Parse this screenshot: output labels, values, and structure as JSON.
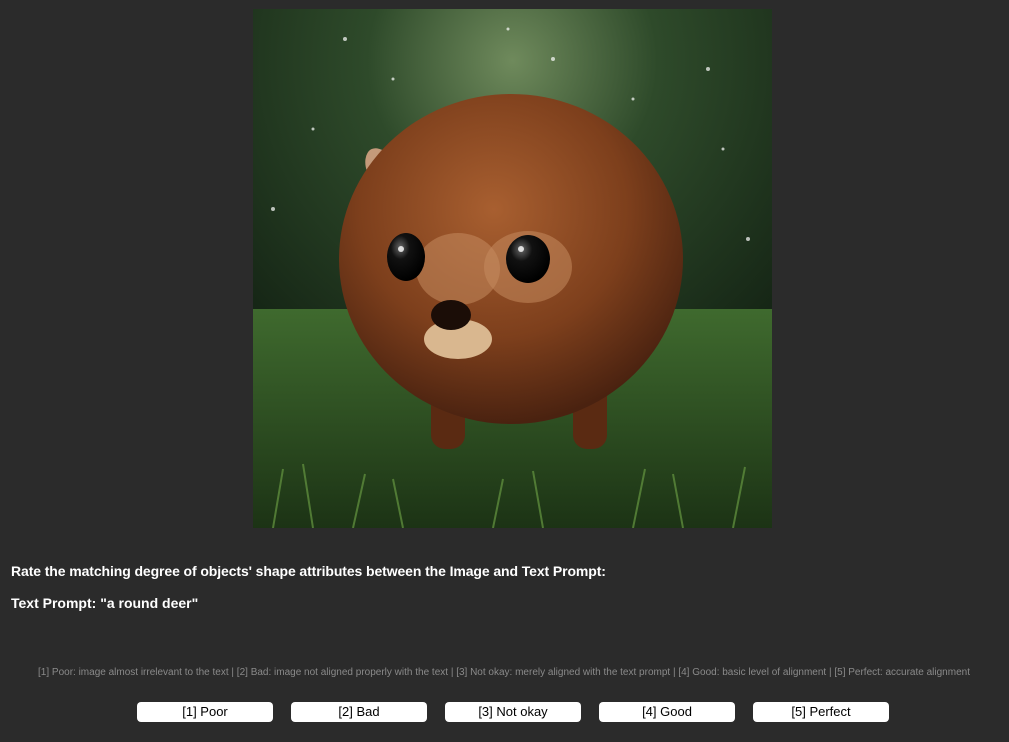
{
  "question": "Rate the matching degree of objects' shape attributes between the Image and Text Prompt:",
  "prompt": "Text Prompt: \"a round deer\"",
  "legend": "[1] Poor: image almost irrelevant to the text  |  [2] Bad: image not aligned properly with the text  |  [3] Not okay: merely aligned with the text prompt | [4] Good: basic level of alignment  |  [5] Perfect: accurate alignment",
  "ratings": [
    {
      "label": "[1] Poor"
    },
    {
      "label": "[2] Bad"
    },
    {
      "label": "[3] Not okay"
    },
    {
      "label": "[4] Good"
    },
    {
      "label": "[5] Perfect"
    }
  ],
  "colors": {
    "background": "#2b2b2b",
    "legend_text": "#8a8a8a",
    "button_bg": "#ffffff"
  }
}
